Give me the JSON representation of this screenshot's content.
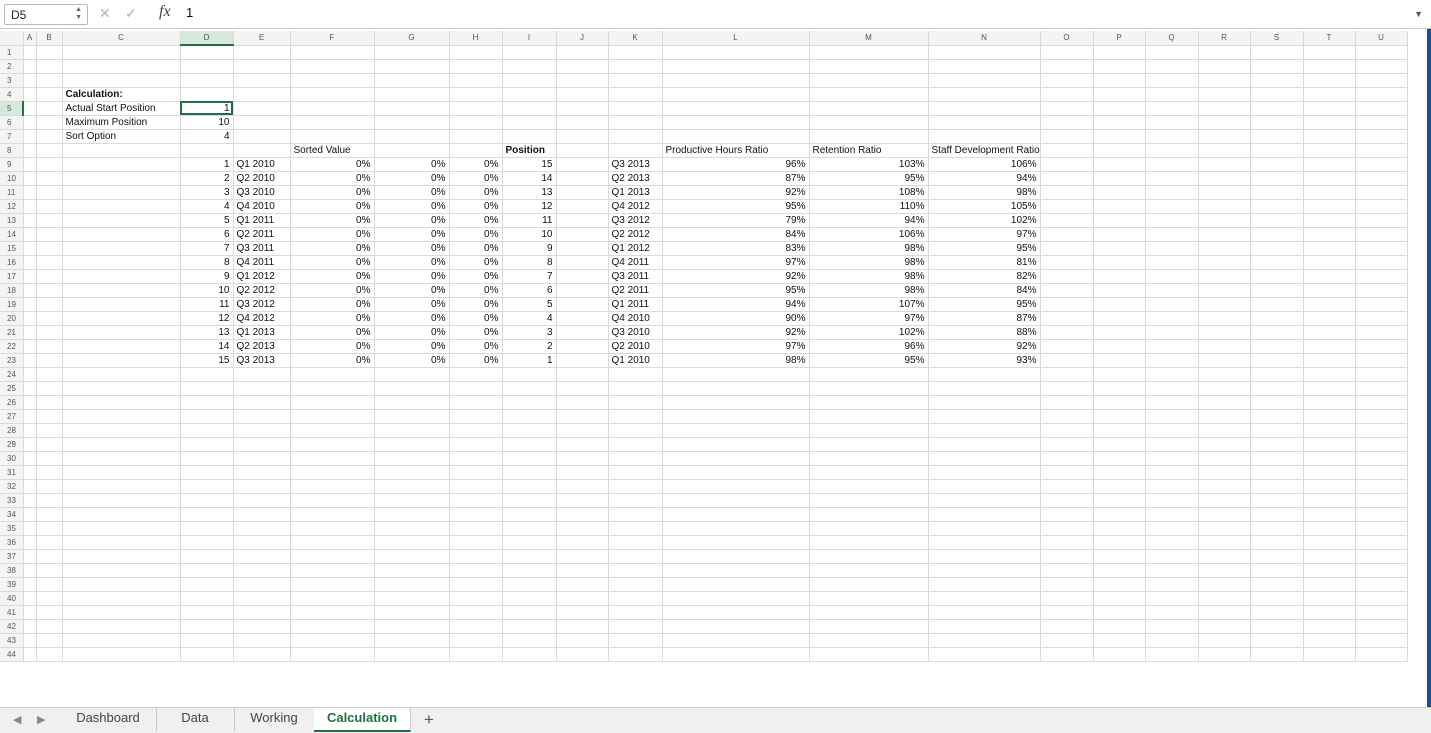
{
  "formula_bar": {
    "name_box": "D5",
    "cancel_icon": "x-icon",
    "confirm_icon": "check-icon",
    "fx_label": "fx",
    "formula": "1"
  },
  "columns": [
    "A",
    "B",
    "C",
    "D",
    "E",
    "F",
    "G",
    "H",
    "I",
    "J",
    "K",
    "L",
    "M",
    "N",
    "O",
    "P",
    "Q",
    "R",
    "S",
    "T",
    "U"
  ],
  "selected_cell": {
    "column": "D",
    "row": 5
  },
  "labels": {
    "c4": "Calculation:",
    "c5": "Actual Start Position",
    "c6": "Maximum Position",
    "c7": "Sort Option",
    "f8": "Sorted Value",
    "i8": "Position",
    "l8": "Productive Hours Ratio",
    "m8": "Retention Ratio",
    "n8": "Staff Development Ratio"
  },
  "params": {
    "d5": "1",
    "d6": "10",
    "d7": "4"
  },
  "table": [
    {
      "d": "1",
      "e": "Q1 2010",
      "f": "0%",
      "g": "0%",
      "h": "0%",
      "i": "15",
      "k": "Q3 2013",
      "l": "96%",
      "m": "103%",
      "n": "106%"
    },
    {
      "d": "2",
      "e": "Q2 2010",
      "f": "0%",
      "g": "0%",
      "h": "0%",
      "i": "14",
      "k": "Q2 2013",
      "l": "87%",
      "m": "95%",
      "n": "94%"
    },
    {
      "d": "3",
      "e": "Q3 2010",
      "f": "0%",
      "g": "0%",
      "h": "0%",
      "i": "13",
      "k": "Q1 2013",
      "l": "92%",
      "m": "108%",
      "n": "98%"
    },
    {
      "d": "4",
      "e": "Q4 2010",
      "f": "0%",
      "g": "0%",
      "h": "0%",
      "i": "12",
      "k": "Q4 2012",
      "l": "95%",
      "m": "110%",
      "n": "105%"
    },
    {
      "d": "5",
      "e": "Q1 2011",
      "f": "0%",
      "g": "0%",
      "h": "0%",
      "i": "11",
      "k": "Q3 2012",
      "l": "79%",
      "m": "94%",
      "n": "102%"
    },
    {
      "d": "6",
      "e": "Q2 2011",
      "f": "0%",
      "g": "0%",
      "h": "0%",
      "i": "10",
      "k": "Q2 2012",
      "l": "84%",
      "m": "106%",
      "n": "97%"
    },
    {
      "d": "7",
      "e": "Q3 2011",
      "f": "0%",
      "g": "0%",
      "h": "0%",
      "i": "9",
      "k": "Q1 2012",
      "l": "83%",
      "m": "98%",
      "n": "95%"
    },
    {
      "d": "8",
      "e": "Q4 2011",
      "f": "0%",
      "g": "0%",
      "h": "0%",
      "i": "8",
      "k": "Q4 2011",
      "l": "97%",
      "m": "98%",
      "n": "81%"
    },
    {
      "d": "9",
      "e": "Q1 2012",
      "f": "0%",
      "g": "0%",
      "h": "0%",
      "i": "7",
      "k": "Q3 2011",
      "l": "92%",
      "m": "98%",
      "n": "82%"
    },
    {
      "d": "10",
      "e": "Q2 2012",
      "f": "0%",
      "g": "0%",
      "h": "0%",
      "i": "6",
      "k": "Q2 2011",
      "l": "95%",
      "m": "98%",
      "n": "84%"
    },
    {
      "d": "11",
      "e": "Q3 2012",
      "f": "0%",
      "g": "0%",
      "h": "0%",
      "i": "5",
      "k": "Q1 2011",
      "l": "94%",
      "m": "107%",
      "n": "95%"
    },
    {
      "d": "12",
      "e": "Q4 2012",
      "f": "0%",
      "g": "0%",
      "h": "0%",
      "i": "4",
      "k": "Q4 2010",
      "l": "90%",
      "m": "97%",
      "n": "87%"
    },
    {
      "d": "13",
      "e": "Q1 2013",
      "f": "0%",
      "g": "0%",
      "h": "0%",
      "i": "3",
      "k": "Q3 2010",
      "l": "92%",
      "m": "102%",
      "n": "88%"
    },
    {
      "d": "14",
      "e": "Q2 2013",
      "f": "0%",
      "g": "0%",
      "h": "0%",
      "i": "2",
      "k": "Q2 2010",
      "l": "97%",
      "m": "96%",
      "n": "92%"
    },
    {
      "d": "15",
      "e": "Q3 2013",
      "f": "0%",
      "g": "0%",
      "h": "0%",
      "i": "1",
      "k": "Q1 2010",
      "l": "98%",
      "m": "95%",
      "n": "93%"
    }
  ],
  "tabs": [
    {
      "label": "Dashboard"
    },
    {
      "label": "Data"
    },
    {
      "label": "Working"
    },
    {
      "label": "Calculation",
      "active": true
    }
  ],
  "add_sheet_label": "+",
  "nav_icons": [
    "chevron-left-icon",
    "chevron-right-icon"
  ],
  "accent_color": "#1e7145"
}
